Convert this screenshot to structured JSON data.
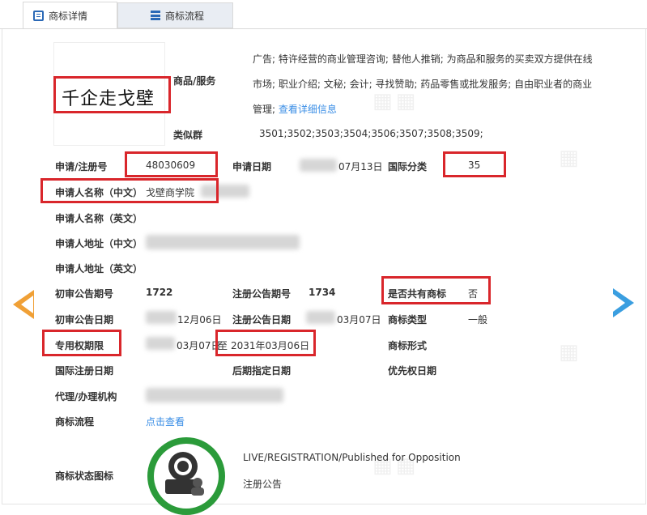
{
  "tabs": {
    "detail": "商标详情",
    "flow": "商标流程"
  },
  "logo": {
    "text": "千企走戈壁"
  },
  "goods": {
    "label": "商品/服务",
    "text": "广告; 特许经营的商业管理咨询; 替他人推销; 为商品和服务的买卖双方提供在线市场; 职业介绍; 文秘; 会计; 寻找赞助; 药品零售或批发服务; 自由职业者的商业管理;",
    "link": "查看详细信息"
  },
  "similar": {
    "label": "类似群",
    "value": "3501;3502;3503;3504;3506;3507;3508;3509;"
  },
  "reg_no": {
    "label": "申请/注册号",
    "value": "48030609"
  },
  "app_date": {
    "label": "申请日期",
    "value": "07月13日"
  },
  "intl_class": {
    "label": "国际分类",
    "value": "35"
  },
  "applicant_cn": {
    "label": "申请人名称（中文）",
    "value": "戈壁商学院"
  },
  "applicant_en": {
    "label": "申请人名称（英文）"
  },
  "address_cn": {
    "label": "申请人地址（中文）"
  },
  "address_en": {
    "label": "申请人地址（英文）"
  },
  "prelim_no": {
    "label": "初审公告期号",
    "value": "1722"
  },
  "reg_pub_no": {
    "label": "注册公告期号",
    "value": "1734"
  },
  "shared": {
    "label": "是否共有商标",
    "value": "否"
  },
  "prelim_date": {
    "label": "初审公告日期",
    "value": "12月06日"
  },
  "reg_pub_date": {
    "label": "注册公告日期",
    "value": "03月07日"
  },
  "tm_type": {
    "label": "商标类型",
    "value": "一般"
  },
  "exclusive": {
    "label": "专用权期限",
    "start": "03月07日",
    "sep": "至",
    "end": "2031年03月06日"
  },
  "tm_form": {
    "label": "商标形式"
  },
  "intl_reg_date": {
    "label": "国际注册日期"
  },
  "later_date": {
    "label": "后期指定日期"
  },
  "priority": {
    "label": "优先权日期"
  },
  "agent": {
    "label": "代理/办理机构"
  },
  "flow": {
    "label": "商标流程",
    "link": "点击查看"
  },
  "status": {
    "label": "商标状态图标",
    "en": "LIVE/REGISTRATION/Published for Opposition",
    "cn": "注册公告"
  },
  "colors": {
    "highlight": "#d9262b",
    "link": "#3a8ee6",
    "badge": "#2b9b3a",
    "prev_arrow": "#f0a036",
    "next_arrow": "#3a9ee0"
  },
  "icons": [
    "document-icon",
    "list-icon",
    "prev-arrow-icon",
    "next-arrow-icon",
    "status-badge-icon"
  ]
}
